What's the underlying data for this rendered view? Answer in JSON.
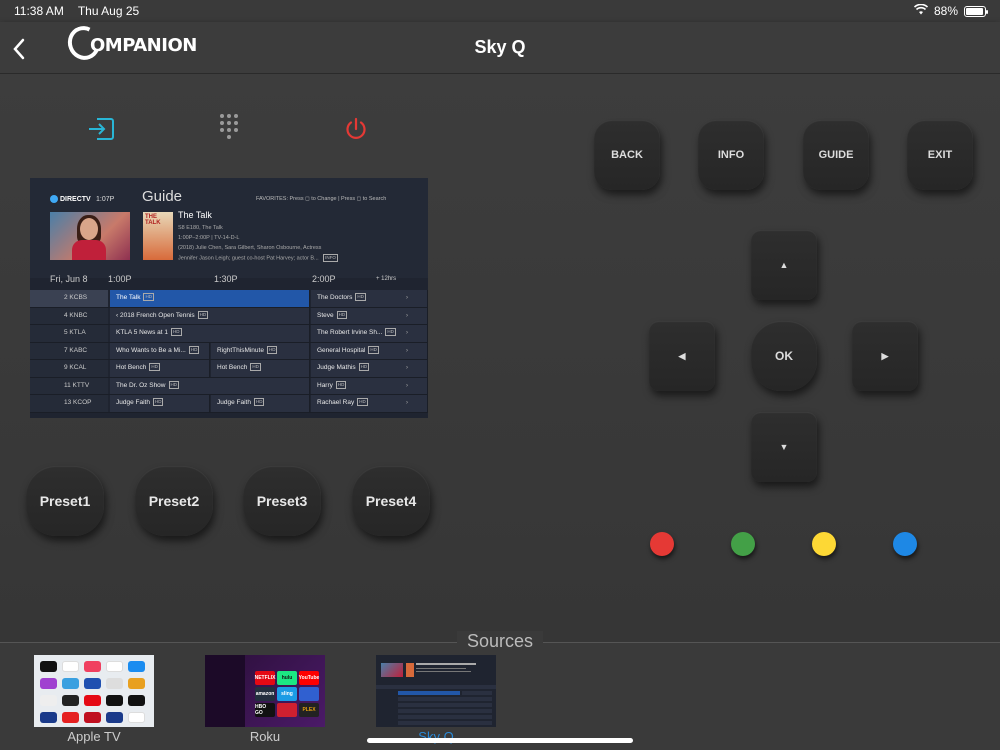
{
  "status_bar": {
    "time": "11:38 AM",
    "date": "Thu Aug 25",
    "battery": "88%"
  },
  "header": {
    "logo_text": "OMPANION",
    "title": "Sky Q"
  },
  "top_icons": {
    "input": "input-icon",
    "keypad": "keypad-icon",
    "power": "power-icon"
  },
  "tv_guide": {
    "provider": "DIRECTV",
    "clock": "1:07P",
    "title": "Guide",
    "favorites_hint": "FAVORITES: Press ◻ to Change  |  Press ◻ to Search",
    "poster_text": "THE TALK",
    "show_title": "The Talk",
    "show_lines": [
      "S8 E180, The Talk",
      "1:00P–2:00P  |  TV-14-D-L",
      "(2018) Julie Chen, Sara Gilbert, Sharon Osbourne, Actress",
      "Jennifer Jason Leigh; guest co-host Pat Harvey; actor B..."
    ],
    "info_badge": "INFO",
    "date_label": "Fri, Jun 8",
    "times": [
      "1:00P",
      "1:30P",
      "2:00P"
    ],
    "skip_label": "+ 12hrs",
    "rows": [
      {
        "ch": "2  KCBS",
        "cells": [
          {
            "t": "The Talk",
            "hd": "HD",
            "w": "a",
            "hl": true
          },
          {
            "t": "The Doctors",
            "hd": "HD",
            "w": "c"
          }
        ]
      },
      {
        "ch": "4  KNBC",
        "cells": [
          {
            "t": "‹ 2018 French Open Tennis",
            "hd": "HD",
            "w": "a"
          },
          {
            "t": "Steve",
            "hd": "HD",
            "w": "c"
          }
        ]
      },
      {
        "ch": "5  KTLA",
        "cells": [
          {
            "t": "KTLA 5 News at 1",
            "hd": "HD",
            "w": "a"
          },
          {
            "t": "The Robert Irvine Sh...",
            "hd": "HD",
            "w": "c"
          }
        ]
      },
      {
        "ch": "7  KABC",
        "cells": [
          {
            "t": "Who Wants to Be a Mi...",
            "hd": "HD",
            "w": "h1"
          },
          {
            "t": "RightThisMinute",
            "hd": "HD",
            "w": "h2"
          },
          {
            "t": "General Hospital",
            "hd": "HD",
            "w": "c"
          }
        ]
      },
      {
        "ch": "9  KCAL",
        "cells": [
          {
            "t": "Hot Bench",
            "hd": "HD",
            "w": "h1"
          },
          {
            "t": "Hot Bench",
            "hd": "HD",
            "w": "h2"
          },
          {
            "t": "Judge Mathis",
            "hd": "HD",
            "w": "c"
          }
        ]
      },
      {
        "ch": "11  KTTV",
        "cells": [
          {
            "t": "The Dr. Oz Show",
            "hd": "HD",
            "w": "a"
          },
          {
            "t": "Harry",
            "hd": "HD",
            "w": "c"
          }
        ]
      },
      {
        "ch": "13  KCOP",
        "cells": [
          {
            "t": "Judge Faith",
            "hd": "HD",
            "w": "h1"
          },
          {
            "t": "Judge Faith",
            "hd": "HD",
            "w": "h2"
          },
          {
            "t": "Rachael Ray",
            "hd": "HD",
            "w": "c"
          }
        ]
      }
    ]
  },
  "presets": [
    "Preset1",
    "Preset2",
    "Preset3",
    "Preset4"
  ],
  "function_buttons": [
    "BACK",
    "INFO",
    "GUIDE",
    "EXIT"
  ],
  "dpad": {
    "up": "▲",
    "left": "◀",
    "ok": "OK",
    "right": "▶",
    "down": "▼"
  },
  "color_buttons": {
    "red": "#e53935",
    "green": "#43a047",
    "yellow": "#fdd835",
    "blue": "#1e88e5"
  },
  "accent_colors": {
    "input_icon": "#29b6d6",
    "power_icon": "#e53935",
    "active_source": "#2a8ad8"
  },
  "sources": {
    "title": "Sources",
    "items": [
      {
        "label": "Apple TV"
      },
      {
        "label": "Roku"
      },
      {
        "label": "Sky Q",
        "active": true
      }
    ]
  },
  "roku_apps": [
    "NETFLIX",
    "hulu",
    "YouTube",
    "amazon",
    "sling",
    "",
    "HBO GO",
    "",
    "PLEX"
  ]
}
